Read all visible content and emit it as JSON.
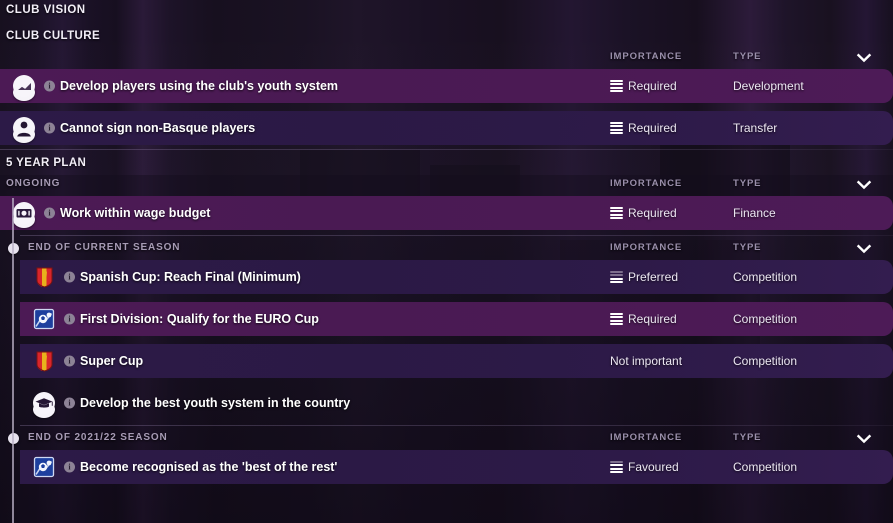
{
  "page": {
    "title": "CLUB VISION"
  },
  "colors": {
    "accent_required_row": "#4a1a53",
    "accent_dark_row": "#2c1a47",
    "background": "#16101f",
    "header_label": "#9a8fab",
    "text": "#ffffff"
  },
  "columns": {
    "importance": "IMPORTANCE",
    "type": "TYPE",
    "collapse_icon": "chevron-down-icon"
  },
  "sections": [
    {
      "id": "club-culture",
      "title": "CLUB CULTURE",
      "has_timeline": false,
      "groups": [
        {
          "id": "culture-main",
          "header": "",
          "show_columns": true,
          "timeline_dot": false,
          "rows": [
            {
              "icon": "growth-chart-icon",
              "label": "Develop players using the club's youth system",
              "importance": "Required",
              "importance_level": 4,
              "type": "Development",
              "style": "required",
              "indent": false
            },
            {
              "icon": "person-icon",
              "label": "Cannot sign non-Basque players",
              "importance": "Required",
              "importance_level": 4,
              "type": "Transfer",
              "style": "dark",
              "indent": false
            }
          ]
        }
      ]
    },
    {
      "id": "five-year-plan",
      "title": "5 YEAR PLAN",
      "has_timeline": true,
      "groups": [
        {
          "id": "ongoing",
          "header": "ONGOING",
          "show_columns": true,
          "timeline_dot": false,
          "rows": [
            {
              "icon": "money-icon",
              "label": "Work within wage budget",
              "importance": "Required",
              "importance_level": 4,
              "type": "Finance",
              "style": "required",
              "indent": false
            }
          ]
        },
        {
          "id": "end-of-current-season",
          "header": "END OF CURRENT SEASON",
          "show_columns": true,
          "timeline_dot": true,
          "rows": [
            {
              "icon": "spanish-cup-badge-icon",
              "label": "Spanish Cup: Reach Final (Minimum)",
              "importance": "Preferred",
              "importance_level": 2,
              "type": "Competition",
              "style": "dark",
              "indent": true
            },
            {
              "icon": "first-division-badge-icon",
              "label": "First Division: Qualify for the EURO Cup",
              "importance": "Required",
              "importance_level": 4,
              "type": "Competition",
              "style": "required",
              "indent": true
            },
            {
              "icon": "spanish-cup-badge-icon",
              "label": "Super Cup",
              "importance": "Not important",
              "importance_level": 0,
              "type": "Competition",
              "style": "dark",
              "indent": true
            },
            {
              "icon": "graduation-cap-icon",
              "label": "Develop the best youth system in the country",
              "importance": "",
              "importance_level": 0,
              "type": "",
              "style": "none",
              "indent": true
            }
          ]
        },
        {
          "id": "end-of-2021-22-season",
          "header": "END OF 2021/22 SEASON",
          "show_columns": true,
          "timeline_dot": true,
          "rows": [
            {
              "icon": "first-division-badge-icon",
              "label": "Become recognised as the 'best of the rest'",
              "importance": "Favoured",
              "importance_level": 3,
              "type": "Competition",
              "style": "dark",
              "indent": true
            }
          ]
        }
      ]
    }
  ]
}
